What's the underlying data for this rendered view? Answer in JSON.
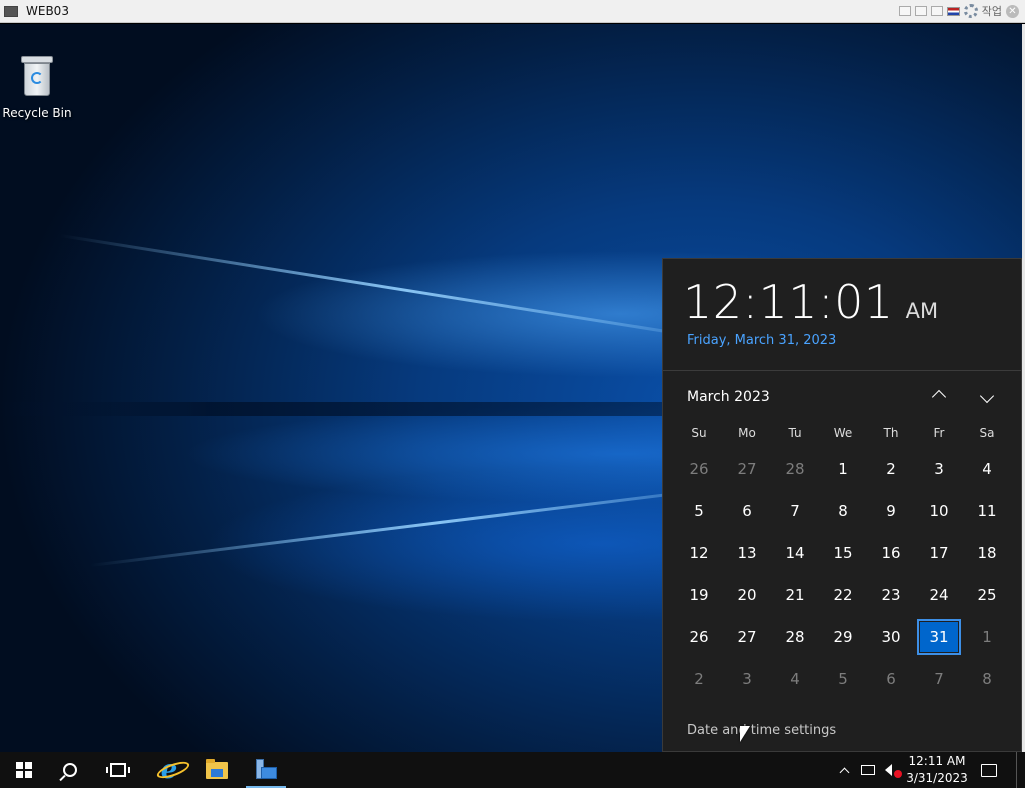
{
  "window": {
    "title": "WEB03",
    "toolbar_text": "작업",
    "close_glyph": "✕"
  },
  "desktop": {
    "icons": [
      {
        "label": "Recycle Bin",
        "icon": "recycle-bin-icon"
      }
    ]
  },
  "flyout": {
    "time": "12:11:01",
    "ampm": "AM",
    "long_date": "Friday, March 31, 2023",
    "month_label": "March 2023",
    "weekdays": [
      "Su",
      "Mo",
      "Tu",
      "We",
      "Th",
      "Fr",
      "Sa"
    ],
    "weeks": [
      [
        "26",
        "27",
        "28",
        "1",
        "2",
        "3",
        "4"
      ],
      [
        "5",
        "6",
        "7",
        "8",
        "9",
        "10",
        "11"
      ],
      [
        "12",
        "13",
        "14",
        "15",
        "16",
        "17",
        "18"
      ],
      [
        "19",
        "20",
        "21",
        "22",
        "23",
        "24",
        "25"
      ],
      [
        "26",
        "27",
        "28",
        "29",
        "30",
        "31",
        "1"
      ],
      [
        "2",
        "3",
        "4",
        "5",
        "6",
        "7",
        "8"
      ]
    ],
    "today": "31",
    "settings_link": "Date and time settings",
    "accent_color": "#0066cc",
    "link_color": "#4aa3ff"
  },
  "taskbar": {
    "apps": [
      "start-icon",
      "search-icon",
      "task-view-icon",
      "internet-explorer-icon",
      "file-explorer-icon",
      "server-manager-icon"
    ],
    "clock_time": "12:11 AM",
    "clock_date": "3/31/2023"
  }
}
